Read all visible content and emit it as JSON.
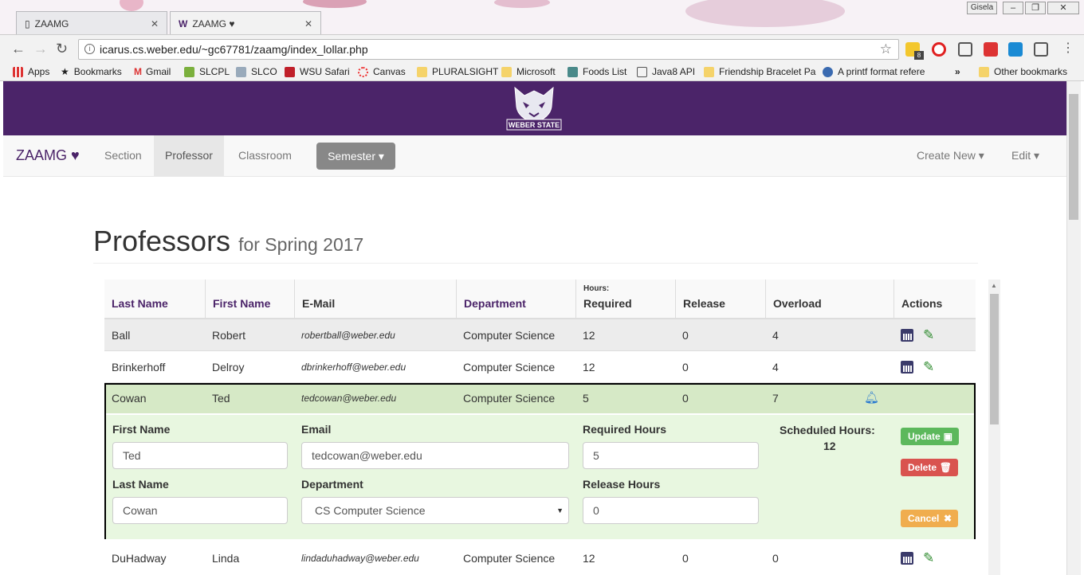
{
  "browser": {
    "tabs": [
      {
        "label": "ZAAMG",
        "active": false
      },
      {
        "label": "ZAAMG ♥",
        "active": true
      }
    ],
    "user_badge": "Gisela",
    "url": "icarus.cs.weber.edu/~gc67781/zaamg/index_lollar.php",
    "extension_badge": "8",
    "bookmarks": [
      "Apps",
      "Bookmarks",
      "Gmail",
      "SLCPL",
      "SLCO",
      "WSU Safari",
      "Canvas",
      "PLURALSIGHT",
      "Microsoft",
      "Foods List",
      "Java8 API",
      "Friendship Bracelet Pa",
      "A printf format refere"
    ],
    "more_bookmarks": "»",
    "other_bookmarks": "Other bookmarks"
  },
  "banner": {
    "logo_text": "WEBER STATE"
  },
  "nav": {
    "brand": "ZAAMG ♥",
    "links": [
      "Section",
      "Professor",
      "Classroom"
    ],
    "semester": "Semester ▾",
    "create_new": "Create New ▾",
    "edit": "Edit ▾"
  },
  "page": {
    "title": "Professors",
    "subtitle": "for Spring 2017"
  },
  "table": {
    "headers": {
      "last_name": "Last Name",
      "first_name": "First Name",
      "email": "E-Mail",
      "department": "Department",
      "hours_super": "Hours:",
      "required": "Required",
      "release": "Release",
      "overload": "Overload",
      "actions": "Actions"
    },
    "rows": [
      {
        "last": "Ball",
        "first": "Robert",
        "email": "robertball@weber.edu",
        "dept": "Computer Science",
        "required": "12",
        "release": "0",
        "overload": "4"
      },
      {
        "last": "Brinkerhoff",
        "first": "Delroy",
        "email": "dbrinkerhoff@weber.edu",
        "dept": "Computer Science",
        "required": "12",
        "release": "0",
        "overload": "4"
      },
      {
        "last": "Cowan",
        "first": "Ted",
        "email": "tedcowan@weber.edu",
        "dept": "Computer Science",
        "required": "5",
        "release": "0",
        "overload": "7"
      },
      {
        "last": "DuHadway",
        "first": "Linda",
        "email": "lindaduhadway@weber.edu",
        "dept": "Computer Science",
        "required": "12",
        "release": "0",
        "overload": "0"
      }
    ]
  },
  "edit_form": {
    "first_name_label": "First Name",
    "first_name_value": "Ted",
    "email_label": "Email",
    "email_value": "tedcowan@weber.edu",
    "required_label": "Required Hours",
    "required_value": "5",
    "scheduled_label": "Scheduled Hours:",
    "scheduled_value": "12",
    "last_name_label": "Last Name",
    "last_name_value": "Cowan",
    "department_label": "Department",
    "department_value": "CS Computer Science",
    "release_label": "Release Hours",
    "release_value": "0",
    "update": "Update",
    "delete": "Delete",
    "cancel": "Cancel"
  },
  "colors": {
    "brand_purple": "#4b2469",
    "update_green": "#5cb85c",
    "delete_red": "#d9534f",
    "cancel_orange": "#f0ad4e"
  }
}
